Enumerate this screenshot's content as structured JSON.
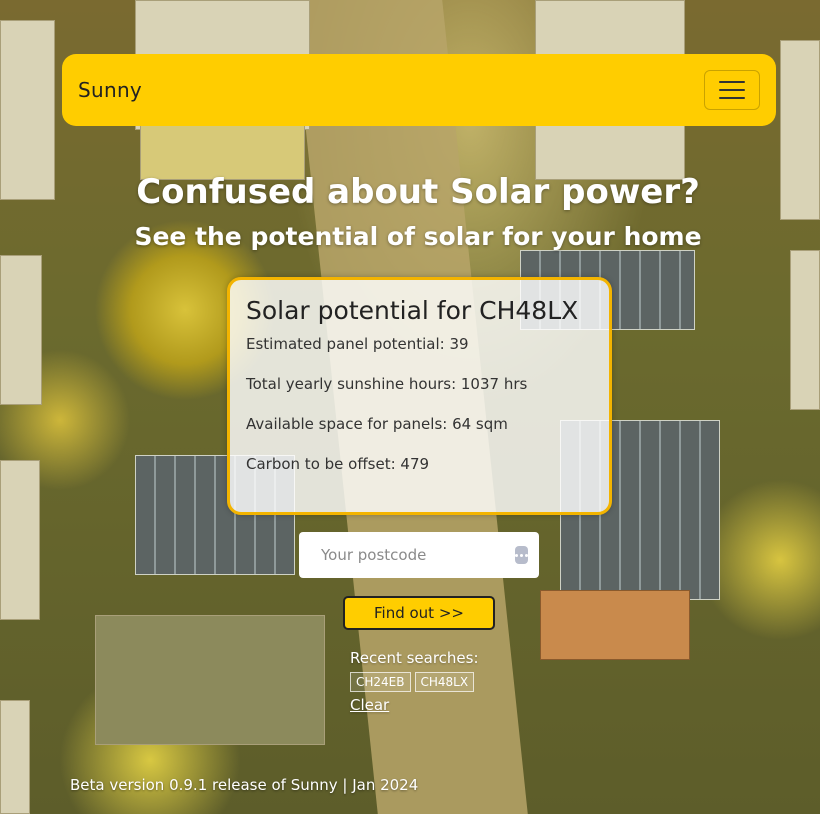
{
  "navbar": {
    "brand": "Sunny",
    "menu_icon": "hamburger-menu-icon"
  },
  "hero": {
    "title": "Confused about Solar power?",
    "subtitle": "See the potential of solar for your home"
  },
  "result_card": {
    "title": "Solar potential for CH48LX",
    "stats": [
      "Estimated panel potential: 39",
      "Total yearly sunshine hours: 1037 hrs",
      "Available space for panels: 64 sqm",
      "Carbon to be offset: 479"
    ]
  },
  "search": {
    "placeholder": "Your postcode",
    "value": "",
    "field_icon": "more-dots-icon",
    "button_label": "Find out >>"
  },
  "recent": {
    "label": "Recent searches:",
    "items": [
      "CH24EB",
      "CH48LX"
    ],
    "clear_label": "Clear"
  },
  "footer": {
    "text": "Beta version 0.9.1 release of Sunny | Jan 2024"
  },
  "colors": {
    "accent": "#ffcd00",
    "card_border": "#f3b400"
  }
}
